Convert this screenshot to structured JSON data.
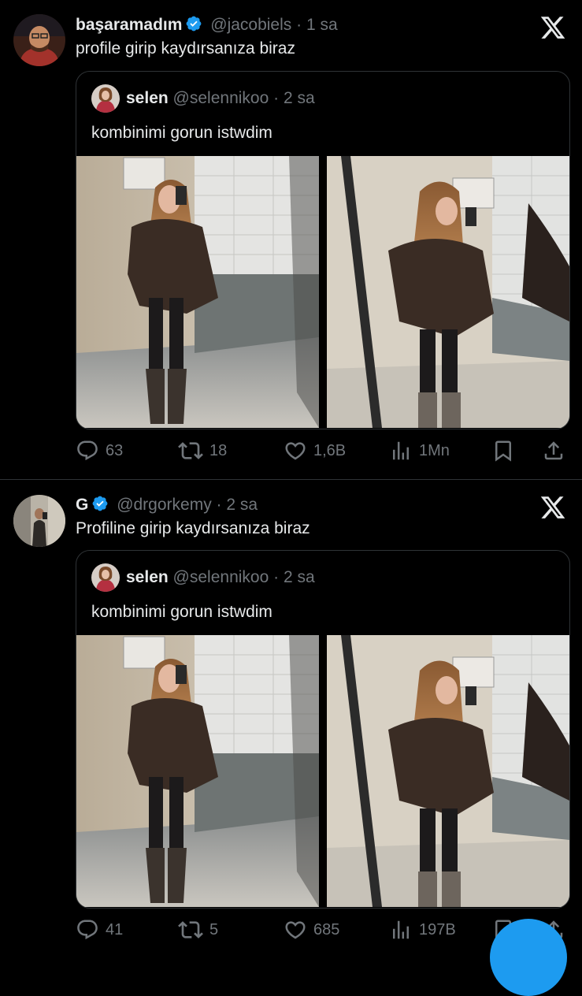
{
  "tweets": [
    {
      "name": "başaramadım",
      "handle": "@jacobiels",
      "dot": "·",
      "time": "1 sa",
      "text": "profile girip kaydırsanıza biraz",
      "quote": {
        "name": "selen",
        "handle": "@selennikoo",
        "dot": "·",
        "time": "2 sa",
        "text": "kombinimi gorun istwdim"
      },
      "stats": {
        "replies": "63",
        "reposts": "18",
        "likes": "1,6B",
        "views": "1Mn"
      }
    },
    {
      "name": "G",
      "handle": "@drgorkemy",
      "dot": "·",
      "time": "2 sa",
      "text": "Profiline girip kaydırsanıza biraz",
      "quote": {
        "name": "selen",
        "handle": "@selennikoo",
        "dot": "·",
        "time": "2 sa",
        "text": "kombinimi gorun istwdim"
      },
      "stats": {
        "replies": "41",
        "reposts": "5",
        "likes": "685",
        "views": "197B"
      }
    }
  ],
  "icons": {
    "verified": "verified-badge-icon",
    "x_logo": "x-logo-icon",
    "reply": "reply-icon",
    "repost": "repost-icon",
    "like": "like-icon",
    "views": "views-icon",
    "bookmark": "bookmark-icon",
    "share": "share-icon"
  },
  "colors": {
    "background": "#000000",
    "text": "#e7e9ea",
    "muted": "#71767b",
    "verified": "#1d9bf0",
    "border": "#2f3336"
  }
}
